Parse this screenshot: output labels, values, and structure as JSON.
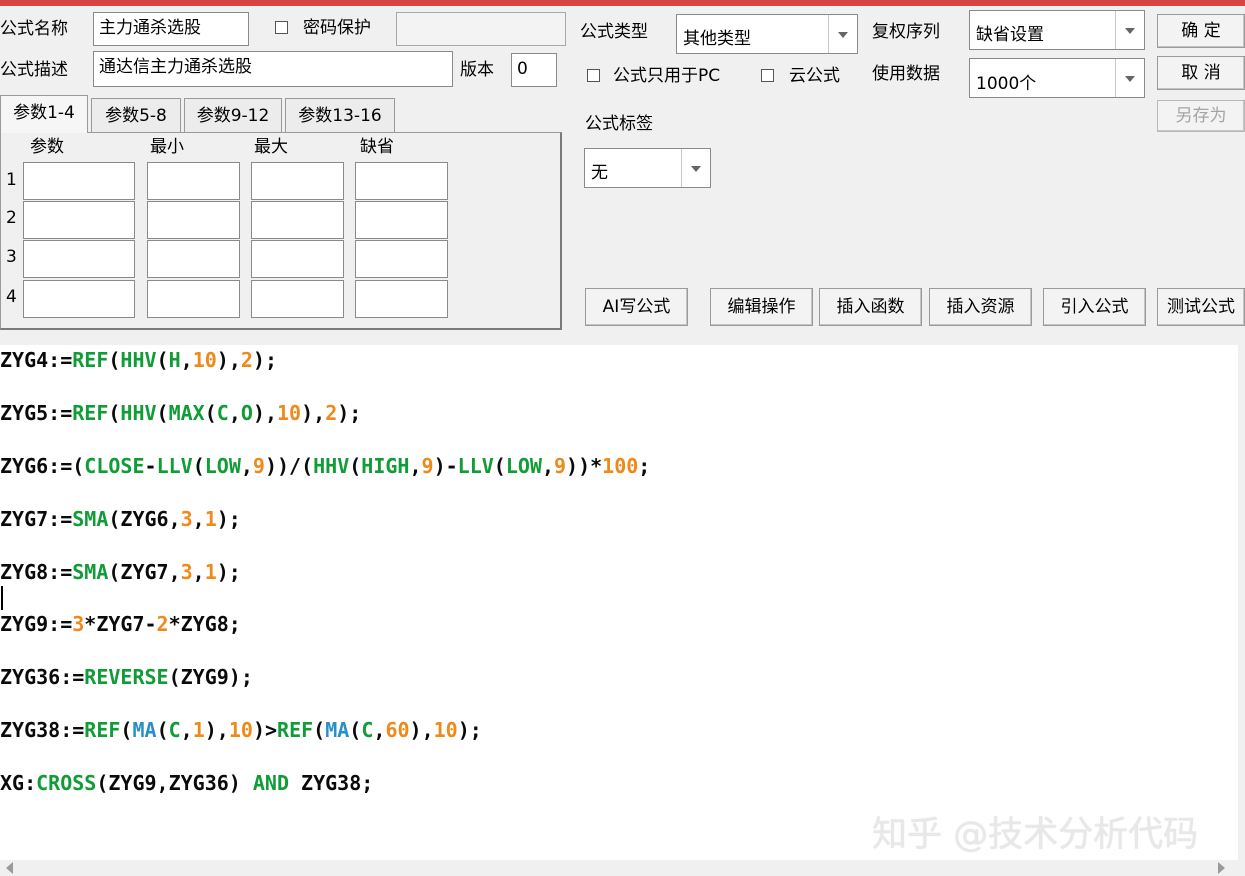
{
  "header": {
    "name_label": "公式名称",
    "name_value": "主力通杀选股",
    "password_label": "密码保护",
    "desc_label": "公式描述",
    "desc_value": "通达信主力通杀选股",
    "version_label": "版本",
    "version_value": "0",
    "type_label": "公式类型",
    "type_value": "其他类型",
    "fq_label": "复权序列",
    "fq_value": "缺省设置",
    "pc_only_label": "公式只用于PC",
    "cloud_label": "云公式",
    "data_label": "使用数据",
    "data_value": "1000个",
    "tag_label": "公式标签",
    "tag_value": "无"
  },
  "buttons": {
    "ok": "确 定",
    "cancel": "取 消",
    "save_as": "另存为",
    "ai": "AI写公式",
    "edit": "编辑操作",
    "insert_func": "插入函数",
    "insert_res": "插入资源",
    "import": "引入公式",
    "test": "测试公式"
  },
  "param_tabs": [
    "参数1-4",
    "参数5-8",
    "参数9-12",
    "参数13-16"
  ],
  "param_headers": [
    "参数",
    "最小",
    "最大",
    "缺省"
  ],
  "param_rows": [
    "1",
    "2",
    "3",
    "4"
  ],
  "code_lines": [
    "ZYG4:=REF(HHV(H,10),2);",
    "ZYG5:=REF(HHV(MAX(C,O),10),2);",
    "ZYG6:=(CLOSE-LLV(LOW,9))/(HHV(HIGH,9)-LLV(LOW,9))*100;",
    "ZYG7:=SMA(ZYG6,3,1);",
    "ZYG8:=SMA(ZYG7,3,1);",
    "ZYG9:=3*ZYG7-2*ZYG8;",
    "ZYG36:=REVERSE(ZYG9);",
    "ZYG38:=REF(MA(C,1),10)>REF(MA(C,60),10);",
    "XG:CROSS(ZYG9,ZYG36) AND ZYG38;"
  ],
  "watermark": "知乎 @技术分析代码",
  "colors": {
    "function": "#109c36",
    "number": "#ef8a1a",
    "ma_function": "#2a8ec8",
    "title_bar": "#d64541"
  }
}
